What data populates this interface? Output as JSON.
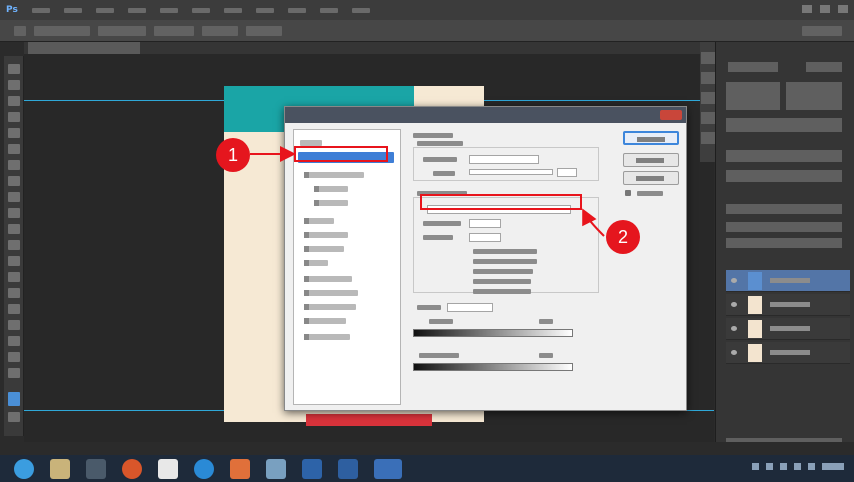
{
  "callouts": [
    {
      "number": "1"
    },
    {
      "number": "2"
    }
  ],
  "colors": {
    "highlight_red": "#e8141c",
    "selection_blue": "#3e7ed6",
    "canvas_cream": "#f6e9d4",
    "canvas_teal": "#1aa5a6",
    "canvas_red": "#d8333b",
    "guide_cyan": "#2fa8d8"
  },
  "icons": {
    "taskbar": [
      "chrome-icon",
      "folder-icon",
      "media-player-icon",
      "firefox-icon",
      "gmail-icon",
      "app-icon",
      "illustrator-icon",
      "photos-icon",
      "photoshop-icon",
      "word-icon",
      "photoshop-icon-active"
    ]
  }
}
